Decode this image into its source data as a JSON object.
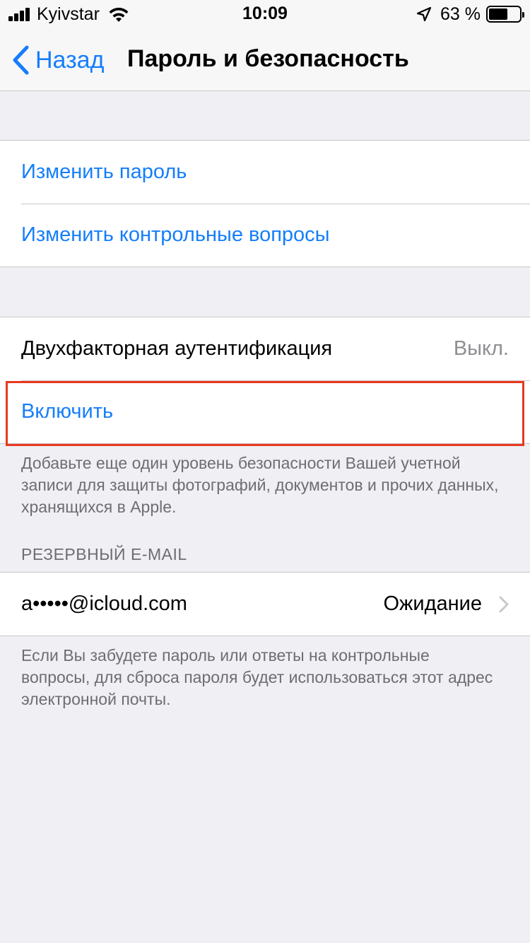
{
  "status_bar": {
    "carrier": "Kyivstar",
    "time": "10:09",
    "battery_percent": "63 %",
    "battery_level": 0.63
  },
  "nav": {
    "back_label": "Назад",
    "title": "Пароль и безопасность"
  },
  "password_group": {
    "change_password": "Изменить пароль",
    "change_questions": "Изменить контрольные вопросы"
  },
  "two_factor": {
    "label": "Двухфакторная аутентификация",
    "value": "Выкл.",
    "enable_label": "Включить",
    "footer": "Добавьте еще один уровень безопасности Вашей учетной записи для защиты фотографий, документов и прочих данных, хранящихся в Apple."
  },
  "backup_email": {
    "header": "РЕЗЕРВНЫЙ E-MAIL",
    "email": "a•••••@icloud.com",
    "status": "Ожидание",
    "footer": "Если Вы забудете пароль или ответы на контрольные вопросы, для сброса пароля будет использоваться этот адрес электронной почты."
  },
  "colors": {
    "accent": "#157efb",
    "highlight": "#e8391e",
    "background": "#efeff4"
  }
}
